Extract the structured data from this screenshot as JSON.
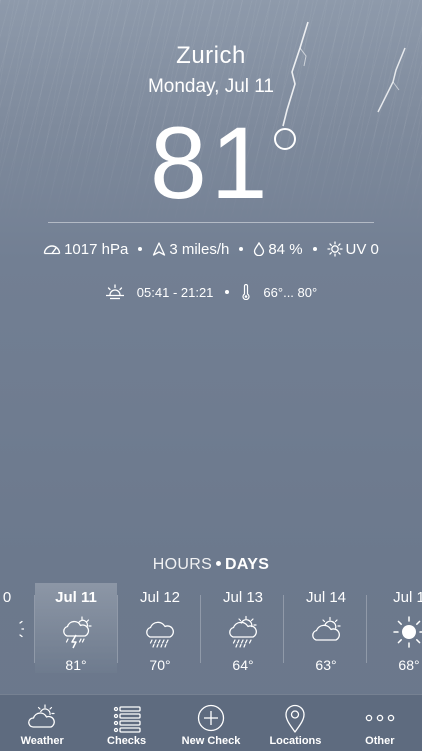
{
  "location": {
    "city": "Zurich",
    "date": "Monday, Jul 11"
  },
  "current": {
    "temperature": "81",
    "pressure": "1017 hPa",
    "wind": "3 miles/h",
    "humidity": "84 %",
    "uv": "UV 0",
    "sunrise_sunset": "05:41 - 21:21",
    "temp_range": "66°... 80°"
  },
  "forecast_toggle": {
    "hours": "HOURS",
    "days": "DAYS"
  },
  "days": [
    {
      "label": "0",
      "temp": "",
      "icon": "partial-sun-icon",
      "selected": false
    },
    {
      "label": "Jul 11",
      "temp": "81°",
      "icon": "thunderstorm-icon",
      "selected": true
    },
    {
      "label": "Jul 12",
      "temp": "70°",
      "icon": "rain-cloud-icon",
      "selected": false
    },
    {
      "label": "Jul 13",
      "temp": "64°",
      "icon": "sun-rain-cloud-icon",
      "selected": false
    },
    {
      "label": "Jul 14",
      "temp": "63°",
      "icon": "sun-cloud-icon",
      "selected": false
    },
    {
      "label": "Jul 1",
      "temp": "68°",
      "icon": "sun-icon",
      "selected": false
    }
  ],
  "tabs": [
    {
      "label": "Weather",
      "icon": "weather-icon"
    },
    {
      "label": "Checks",
      "icon": "list-icon"
    },
    {
      "label": "New Check",
      "icon": "plus-circle-icon"
    },
    {
      "label": "Locations",
      "icon": "location-pin-icon"
    },
    {
      "label": "Other",
      "icon": "more-icon"
    }
  ]
}
